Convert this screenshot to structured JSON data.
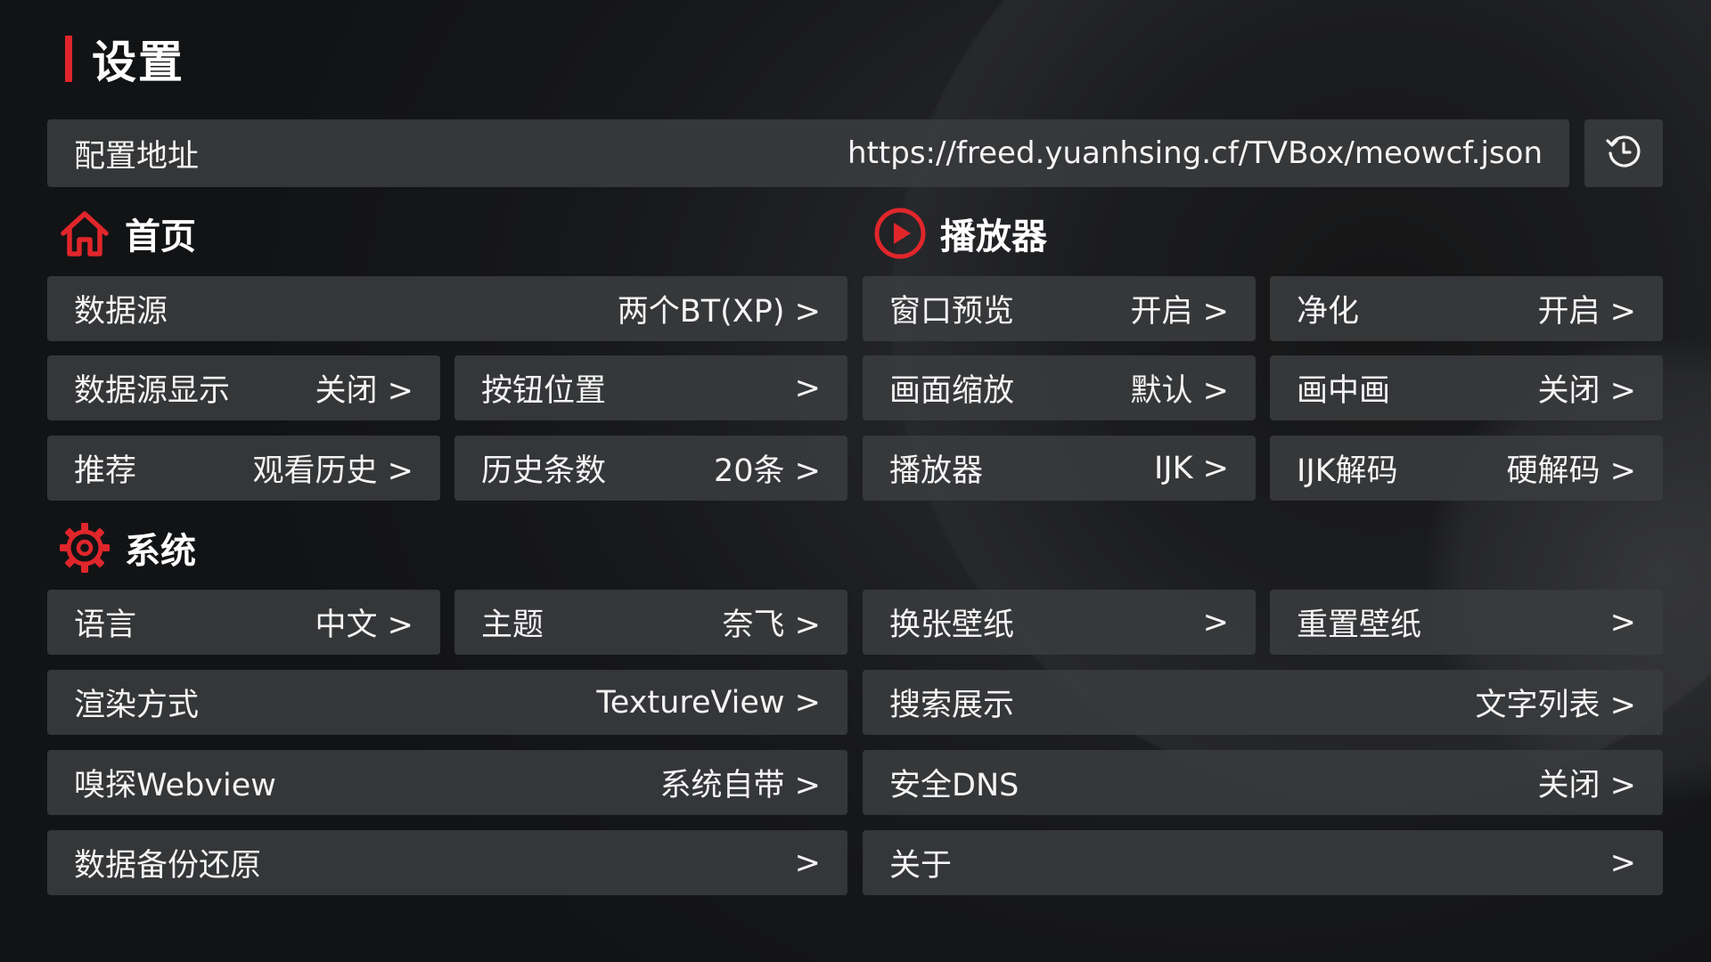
{
  "page": {
    "title": "设置"
  },
  "config": {
    "label": "配置地址",
    "url": "https://freed.yuanhsing.cf/TVBox/meowcf.json",
    "history_icon": "history-icon"
  },
  "sections": {
    "home": {
      "label": "首页",
      "icon": "home-icon"
    },
    "player": {
      "label": "播放器",
      "icon": "play-circle-icon"
    },
    "system": {
      "label": "系统",
      "icon": "gear-icon"
    }
  },
  "settings": {
    "data_source": {
      "label": "数据源",
      "value": "两个BT(XP) >"
    },
    "source_display": {
      "label": "数据源显示",
      "value": "关闭 >"
    },
    "button_position": {
      "label": "按钮位置",
      "value": ">"
    },
    "recommend": {
      "label": "推荐",
      "value": "观看历史 >"
    },
    "history_count": {
      "label": "历史条数",
      "value": "20条 >"
    },
    "window_preview": {
      "label": "窗口预览",
      "value": "开启 >"
    },
    "purify": {
      "label": "净化",
      "value": "开启 >"
    },
    "scale": {
      "label": "画面缩放",
      "value": "默认 >"
    },
    "pip": {
      "label": "画中画",
      "value": "关闭 >"
    },
    "player": {
      "label": "播放器",
      "value": "IJK >"
    },
    "ijk_decode": {
      "label": "IJK解码",
      "value": "硬解码 >"
    },
    "language": {
      "label": "语言",
      "value": "中文 >"
    },
    "theme": {
      "label": "主题",
      "value": "奈飞 >"
    },
    "change_wallpaper": {
      "label": "换张壁纸",
      "value": ">"
    },
    "reset_wallpaper": {
      "label": "重置壁纸",
      "value": ">"
    },
    "render_mode": {
      "label": "渲染方式",
      "value": "TextureView >"
    },
    "search_display": {
      "label": "搜索展示",
      "value": "文字列表 >"
    },
    "sniff_webview": {
      "label": "嗅探Webview",
      "value": "系统自带 >"
    },
    "secure_dns": {
      "label": "安全DNS",
      "value": "关闭 >"
    },
    "backup_restore": {
      "label": "数据备份还原",
      "value": ">"
    },
    "about": {
      "label": "关于",
      "value": ">"
    }
  },
  "colors": {
    "accent": "#e0262b",
    "row_bg": "#3a3b3e",
    "background": "#111214"
  }
}
